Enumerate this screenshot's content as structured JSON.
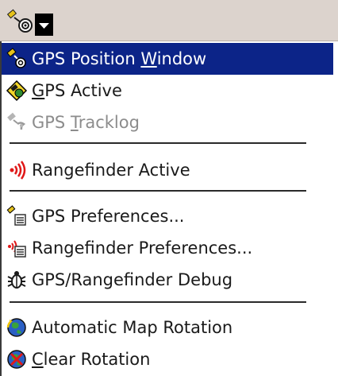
{
  "menu": {
    "items": [
      {
        "pre": "GPS Position ",
        "acc": "W",
        "post": "indow",
        "icon": "gps-satellite-icon",
        "selected": true
      },
      {
        "pre": "",
        "acc": "G",
        "post": "PS Active",
        "icon": "gps-active-icon"
      },
      {
        "pre": "GPS ",
        "acc": "T",
        "post": "racklog",
        "icon": "gps-tracklog-icon",
        "disabled": true
      },
      {
        "pre": "Rangefinder Active",
        "acc": "",
        "post": "",
        "icon": "rangefinder-icon"
      },
      {
        "pre": "GPS Preferences...",
        "acc": "",
        "post": "",
        "icon": "gps-preferences-icon"
      },
      {
        "pre": "Rangefinder Preferences...",
        "acc": "",
        "post": "",
        "icon": "rangefinder-preferences-icon"
      },
      {
        "pre": "GPS/Rangefinder Debug",
        "acc": "",
        "post": "",
        "icon": "bug-icon"
      },
      {
        "pre": "Automatic Map Rotation",
        "acc": "",
        "post": "",
        "icon": "map-rotation-icon"
      },
      {
        "pre": "",
        "acc": "C",
        "post": "lear Rotation",
        "icon": "clear-rotation-icon"
      }
    ]
  },
  "colors": {
    "selected_bg": "#0c2488",
    "toolbar_bg": "#dcd3cd",
    "disabled_text": "#8c8c8c"
  }
}
